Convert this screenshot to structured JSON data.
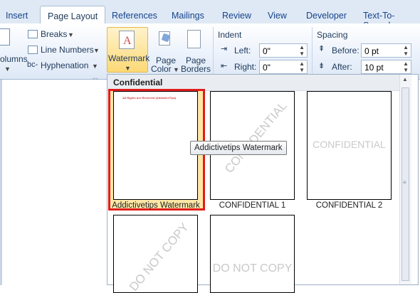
{
  "tabs": [
    "Insert",
    "Page Layout",
    "References",
    "Mailings",
    "Review",
    "View",
    "Developer",
    "Text-To-Speech"
  ],
  "ribbon": {
    "columns_label": "olumns",
    "breaks_label": "Breaks",
    "line_numbers_label": "Line Numbers",
    "hyphenation_label": "Hyphenation",
    "watermark_label": "Watermark",
    "page_color_label_1": "Page",
    "page_color_label_2": "Color",
    "page_borders_label_1": "Page",
    "page_borders_label_2": "Borders",
    "indent": {
      "title": "Indent",
      "left_label": "Left:",
      "left_value": "0\"",
      "right_label": "Right:",
      "right_value": "0\""
    },
    "spacing": {
      "title": "Spacing",
      "before_label": "Before:",
      "before_value": "0 pt",
      "after_label": "After:",
      "after_value": "10 pt"
    }
  },
  "gallery": {
    "section_title": "Confidential",
    "items": [
      {
        "caption": "Addictivetips Watermark",
        "watermark": "All Rights Are Reserved (AddictiveTips)"
      },
      {
        "caption": "CONFIDENTIAL 1",
        "watermark": "CONFIDENTIAL"
      },
      {
        "caption": "CONFIDENTIAL 2",
        "watermark": "CONFIDENTIAL"
      },
      {
        "caption": "",
        "watermark": "DO NOT COPY"
      },
      {
        "caption": "",
        "watermark": "DO NOT COPY"
      }
    ]
  },
  "tooltip": "Addictivetips Watermark",
  "colors": {
    "highlight_border": "#e11c1c",
    "selected_bg": "#fde7a7",
    "ribbon_text": "#1e395b"
  }
}
